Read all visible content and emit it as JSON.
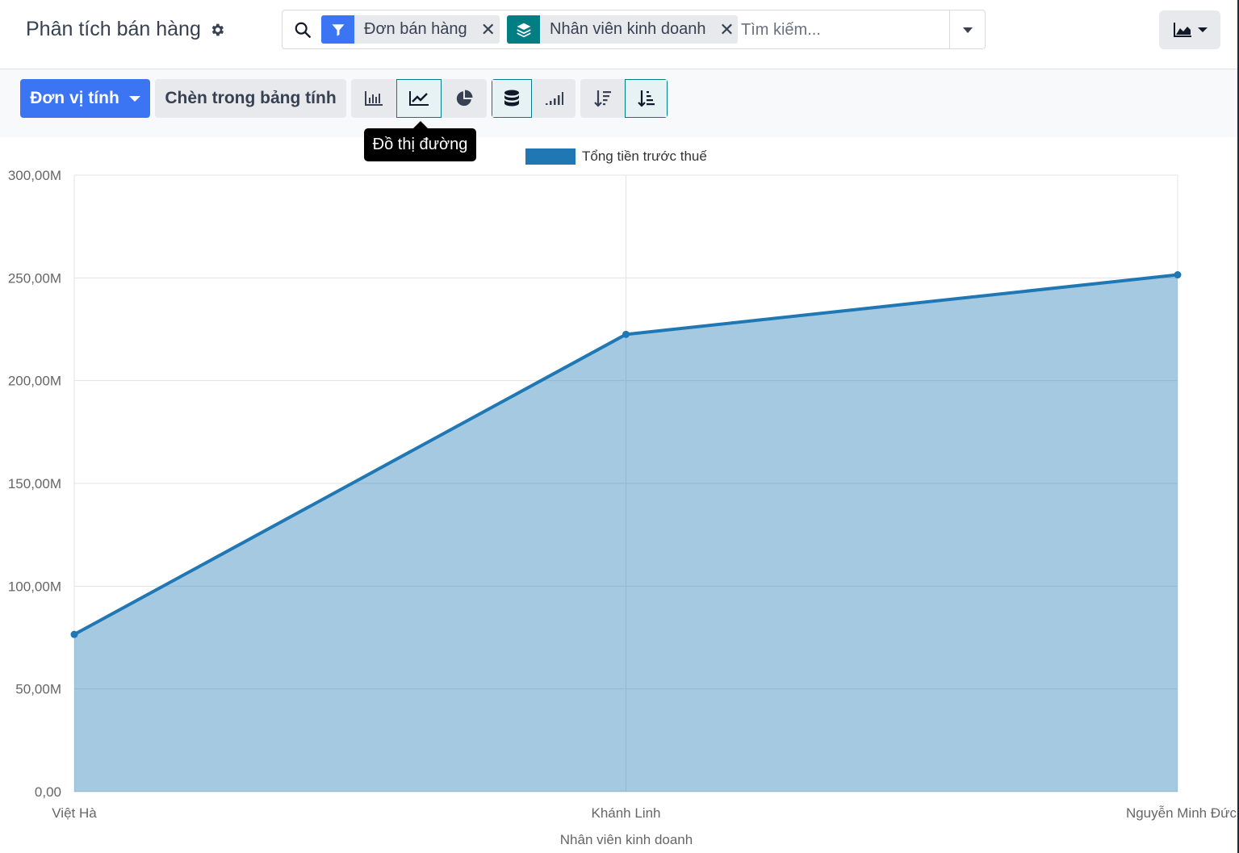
{
  "header": {
    "title": "Phân tích bán hàng"
  },
  "search": {
    "facets": [
      {
        "label": "Đơn bán hàng",
        "icon": "filter-icon",
        "color": "#3b75f3"
      },
      {
        "label": "Nhân viên kinh doanh",
        "icon": "layers-icon",
        "color": "#017e84"
      }
    ],
    "placeholder": "Tìm kiếm..."
  },
  "toolbar": {
    "measure_label": "Đơn vị tính",
    "insert_label": "Chèn trong bảng tính",
    "chart_types": [
      "bar-chart-icon",
      "line-chart-icon",
      "pie-chart-icon"
    ],
    "active_chart": "line-chart-icon",
    "tooltip": "Đồ thị đường"
  },
  "colors": {
    "primary": "#3b75f3",
    "accent": "#017e84",
    "series": "#1f77b4"
  },
  "chart_data": {
    "type": "area",
    "categories": [
      "Việt Hà",
      "Khánh Linh",
      "Nguyễn Minh Đức"
    ],
    "series": [
      {
        "name": "Tổng tiền trước thuế",
        "values": [
          76500000,
          222500000,
          251500000
        ]
      }
    ],
    "xlabel": "Nhân viên kinh doanh",
    "ylabel": "",
    "ylim": [
      0,
      300000000
    ],
    "yticks": [
      "0,00",
      "50,00M",
      "100,00M",
      "150,00M",
      "200,00M",
      "250,00M",
      "300,00M"
    ],
    "grid": true,
    "legend": "top-center"
  }
}
